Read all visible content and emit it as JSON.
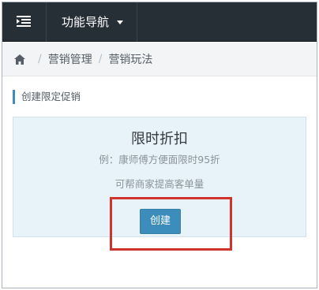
{
  "navbar": {
    "menu_icon": "menu-collapse-icon",
    "dropdown_label": "功能导航",
    "dropdown_icon": "caret-down-icon"
  },
  "breadcrumb": {
    "home_icon": "home-icon",
    "items": [
      "营销管理",
      "营销玩法"
    ],
    "separator": "/"
  },
  "section": {
    "title": "创建限定促销"
  },
  "promo_card": {
    "title": "限时折扣",
    "example": "例：康师傅方便面限时95折",
    "description": "可帮商家提高客单量",
    "button_label": "创建"
  },
  "colors": {
    "navbar_bg": "#262e36",
    "accent": "#3c8dbc",
    "card_bg": "#e8f2f9",
    "highlight": "#d0332b"
  }
}
